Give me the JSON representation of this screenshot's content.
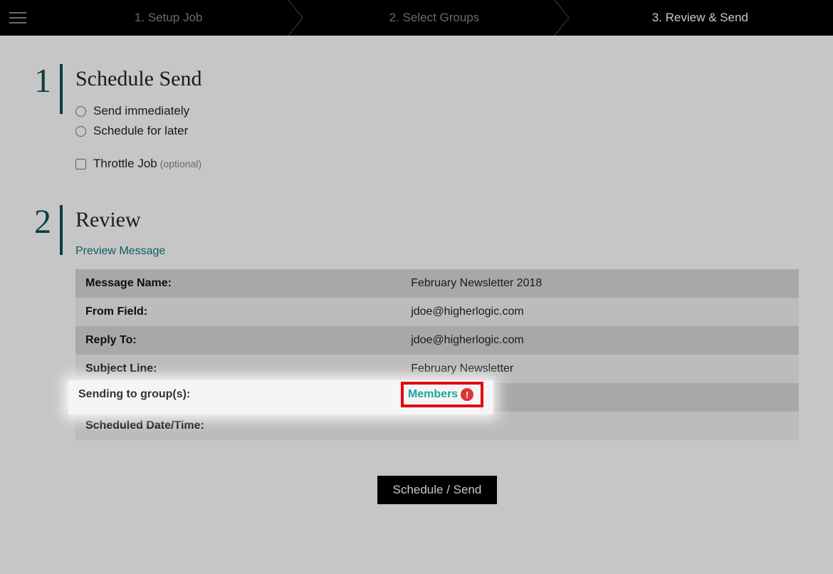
{
  "topbar": {
    "steps": [
      {
        "label": "1. Setup Job"
      },
      {
        "label": "2. Select Groups"
      },
      {
        "label": "3. Review & Send"
      }
    ],
    "active_step_index": 2
  },
  "section_schedule": {
    "number": "1",
    "title": "Schedule Send",
    "radios": [
      {
        "label": "Send immediately"
      },
      {
        "label": "Schedule for later"
      }
    ],
    "throttle_label": "Throttle Job",
    "throttle_hint": "(optional)"
  },
  "section_review": {
    "number": "2",
    "title": "Review",
    "preview_link": "Preview Message",
    "rows": [
      {
        "label": "Message Name:",
        "value": "February Newsletter 2018"
      },
      {
        "label": "From Field:",
        "value": "jdoe@higherlogic.com"
      },
      {
        "label": "Reply To:",
        "value": "jdoe@higherlogic.com"
      },
      {
        "label": "Subject Line:",
        "value": "February Newsletter"
      },
      {
        "label": "Sending to group(s):",
        "value": "Members"
      },
      {
        "label": "Scheduled Date/Time:",
        "value": ""
      }
    ]
  },
  "highlight": {
    "label": "Sending to group(s):",
    "value": "Members",
    "warn_glyph": "!"
  },
  "action": {
    "send_label": "Schedule / Send"
  }
}
